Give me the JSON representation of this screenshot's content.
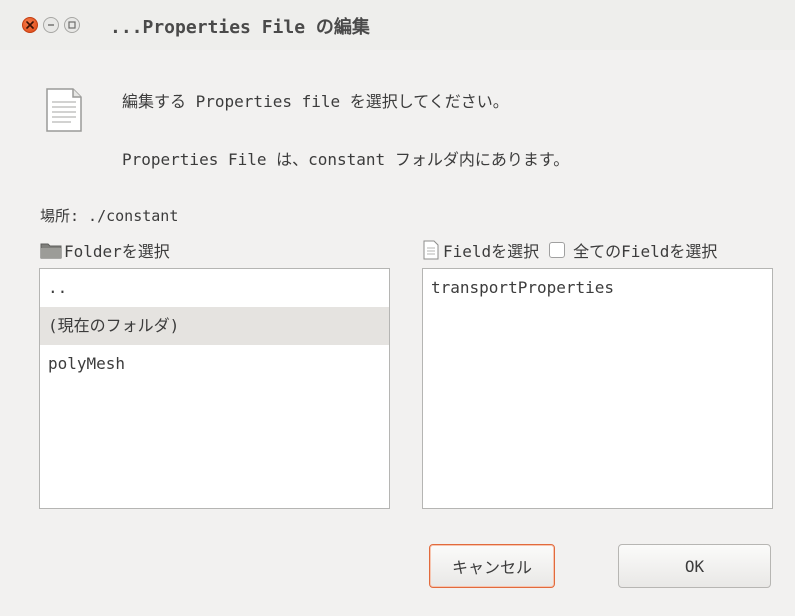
{
  "window": {
    "title": "...Properties File の編集"
  },
  "dialog": {
    "message_line1": "編集する Properties file を選択してください。",
    "message_line2": "Properties File は、constant フォルダ内にあります。",
    "location": "場所: ./constant"
  },
  "folder_panel": {
    "label": "Folderを選択",
    "items": [
      {
        "label": ".."
      },
      {
        "label": "(現在のフォルダ)",
        "selected": true
      },
      {
        "label": "polyMesh"
      }
    ]
  },
  "field_panel": {
    "label": "Fieldを選択",
    "select_all_label": "全てのFieldを選択",
    "select_all_checked": false,
    "items": [
      {
        "label": "transportProperties"
      }
    ]
  },
  "buttons": {
    "cancel_label": "キャンセル",
    "ok_label": "OK"
  },
  "colors": {
    "close_button": "#dd4814",
    "cancel_focus_border": "#e26a3c",
    "selected_row": "#e5e3e0"
  }
}
